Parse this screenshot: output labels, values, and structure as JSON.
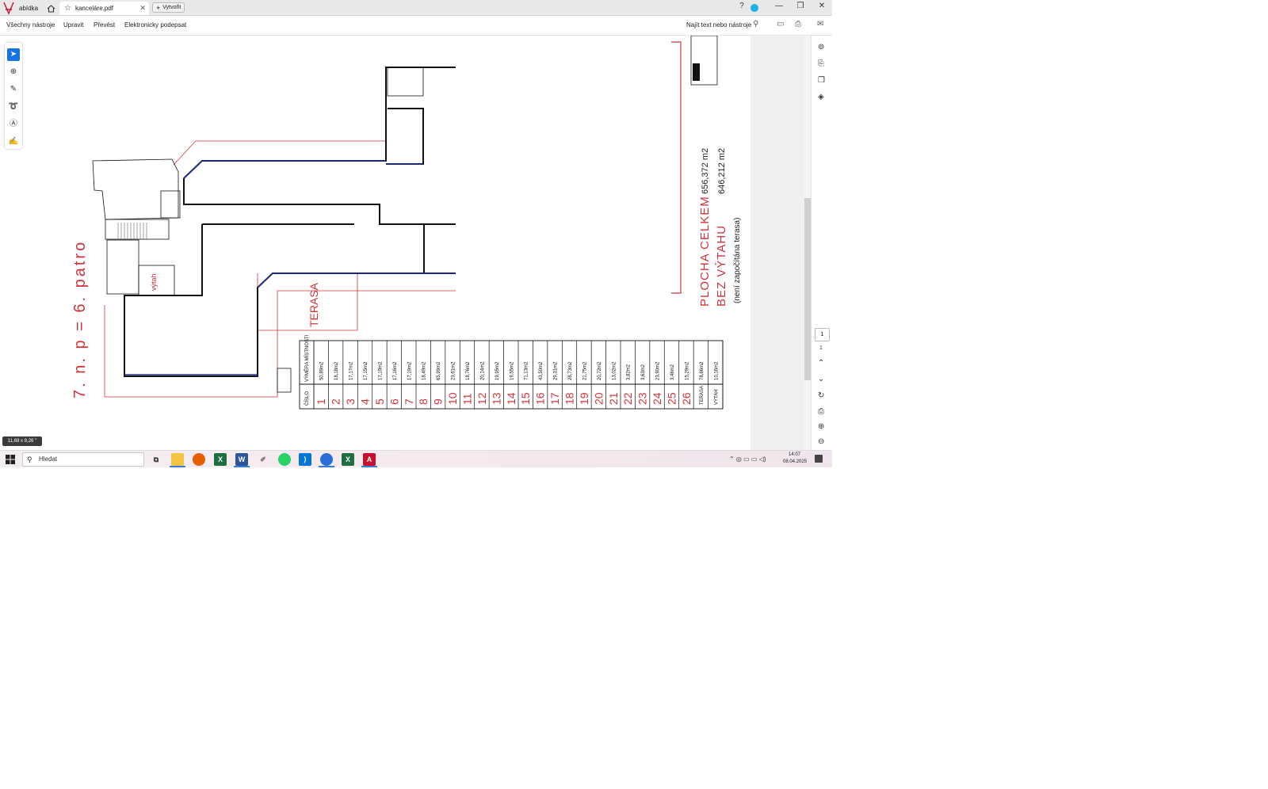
{
  "browser": {
    "menu_tab": "abídka",
    "doc_tab": "kanceláre.pdf",
    "new_tab": "Vytvořit"
  },
  "menu": {
    "items": [
      "Všechny nástroje",
      "Upravit",
      "Převést",
      "Elektronicky podepsat"
    ],
    "search": "Najít text nebo nástroje"
  },
  "page_size": "11,69 x 8,26 \"",
  "navigation": {
    "current_page": "1",
    "total_pages": "1"
  },
  "taskbar": {
    "search": "Hledat",
    "time": "14:07",
    "date": "08.04.2025"
  },
  "drawing": {
    "floor_label": "7. n. p = 6. patro",
    "terasa": "TERASA",
    "vytah": "výtah",
    "totals": {
      "plocha_celkem_label": "PLOCHA CELKEM",
      "plocha_celkem_value": "656,372 m2",
      "bez_vytahu_label": "BEZ VÝTAHU",
      "bez_vytahu_value": "646,212 m2",
      "note": "(není započítána terasa)"
    },
    "table": {
      "header_area": "VÝMĚRA MÍSTNOSTI",
      "header_num": "ČÍSLO",
      "areas": [
        "50,89m2",
        "18,18m2",
        "17,17m2",
        "17,15m2",
        "17,19m2",
        "17,16m2",
        "17,19m2",
        "18,49m2",
        "65,99m2",
        "23,61m2",
        "18,76m2",
        "20,14m2",
        "19,95m2",
        "19,55m2",
        "71,13m2",
        "43,50m2",
        "29,31m2",
        "28,73m2",
        "21,75m2",
        "20,72m2",
        "13,02m2",
        "3,82m2",
        "3,63m2",
        "23,90m2",
        "3,46m2",
        "15,29m2",
        "78,66m2",
        "10,16m2"
      ],
      "numbers": [
        "1",
        "2",
        "3",
        "4",
        "5",
        "6",
        "7",
        "8",
        "9",
        "10",
        "11",
        "12",
        "13",
        "14",
        "15",
        "16",
        "17",
        "18",
        "19",
        "20",
        "21",
        "22",
        "23",
        "24",
        "25",
        "26",
        "TERASA",
        "VÝTAH"
      ]
    }
  },
  "colors": {
    "accent": "#1473e6",
    "drawing_red": "#d0333a",
    "drawing_blue": "#1f2e8c"
  }
}
